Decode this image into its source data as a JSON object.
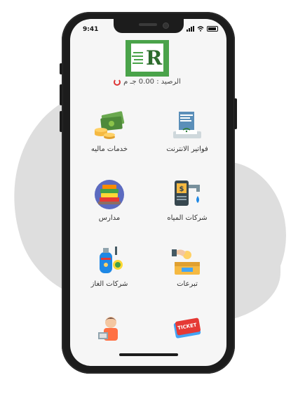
{
  "status_bar": {
    "time": "9:41"
  },
  "app": {
    "logo_letter": "R",
    "balance_text": "الرصيد : 0.00 جـ م"
  },
  "services": [
    {
      "label": "فواتير الانترنت",
      "icon": "internet-bill-icon"
    },
    {
      "label": "خدمات ماليه",
      "icon": "money-icon"
    },
    {
      "label": "شركات المياه",
      "icon": "water-company-icon"
    },
    {
      "label": "مدارس",
      "icon": "school-books-icon"
    },
    {
      "label": "تبرعات",
      "icon": "donation-box-icon"
    },
    {
      "label": "شركات الغاز",
      "icon": "gas-cylinder-icon"
    },
    {
      "label": "",
      "icon": "ticket-icon"
    },
    {
      "label": "",
      "icon": "employee-icon"
    }
  ],
  "colors": {
    "logo_green": "#4aa34a",
    "refresh_red": "#dd3333"
  }
}
